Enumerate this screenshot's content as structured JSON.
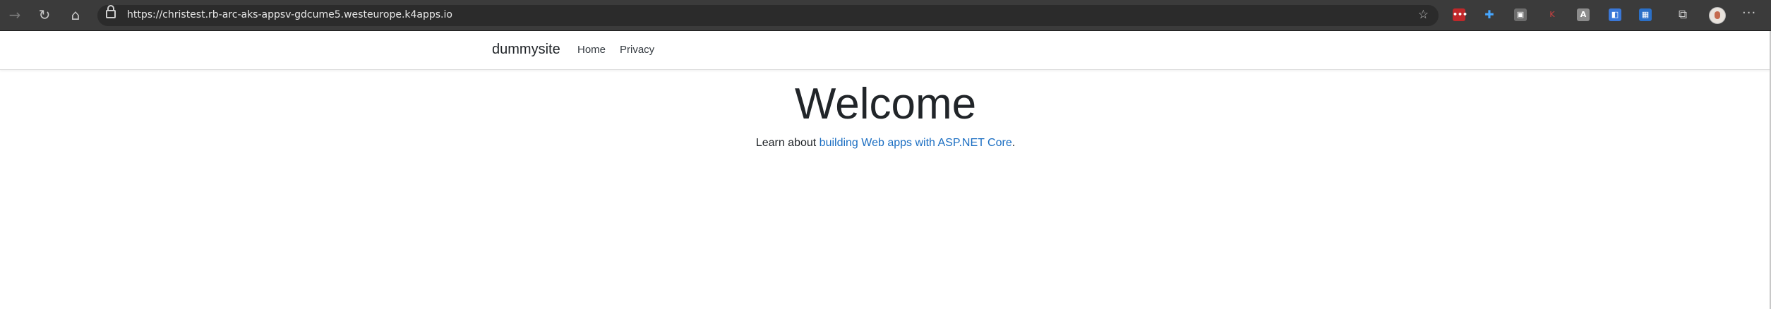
{
  "browser": {
    "url": "https://christest.rb-arc-aks-appsv-gdcume5.westeurope.k4apps.io",
    "icons": {
      "back": "arrow-right-icon",
      "reload": "reload-icon",
      "home": "home-icon",
      "lock": "lock-icon",
      "favorite": "star-plus-icon",
      "collections": "collections-icon",
      "more": "more-icon"
    },
    "extensions": [
      "ext-red",
      "ext-blue-cross",
      "ext-gray",
      "ext-k",
      "ext-gray-2",
      "ext-blue",
      "ext-blue-2"
    ],
    "extension_glyphs": [
      "•••",
      "✚",
      "▣",
      "K",
      "A",
      "◧",
      "▦"
    ]
  },
  "site": {
    "brand": "dummysite",
    "nav": {
      "home": "Home",
      "privacy": "Privacy"
    },
    "heading": "Welcome",
    "lead_prefix": "Learn about ",
    "lead_link": "building Web apps with ASP.NET Core",
    "lead_suffix": "."
  },
  "colors": {
    "link": "#1b6ec2",
    "chrome": "#3b3b3b"
  }
}
